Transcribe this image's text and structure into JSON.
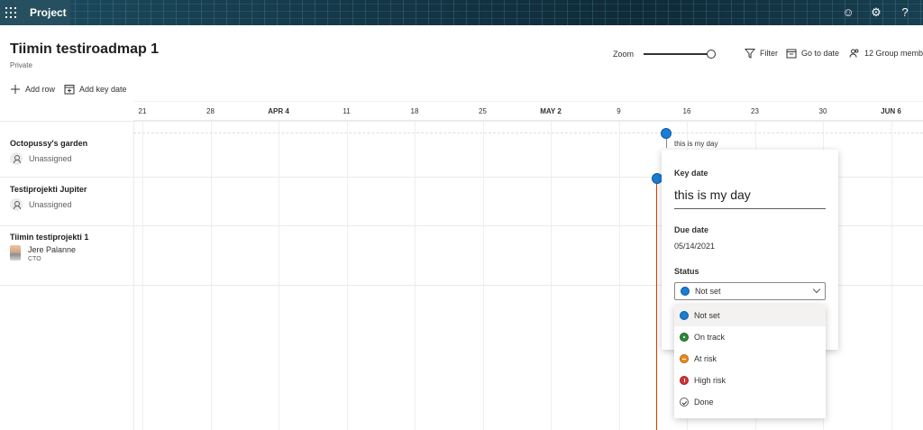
{
  "app": {
    "name": "Project"
  },
  "roadmap": {
    "title": "Tiimin testiroadmap 1",
    "privacy": "Private"
  },
  "toolbar": {
    "zoom_label": "Zoom",
    "zoom_level": 0.95,
    "filter_label": "Filter",
    "goto_label": "Go to date",
    "members_label": "12 Group memb",
    "add_row_label": "Add row",
    "add_key_date_label": "Add key date"
  },
  "timeline": {
    "ticks": [
      "21",
      "28",
      "APR 4",
      "11",
      "18",
      "25",
      "MAY 2",
      "9",
      "16",
      "23",
      "30",
      "JUN 6"
    ]
  },
  "rows": [
    {
      "name": "Octopussy's garden",
      "assignee": "Unassigned"
    },
    {
      "name": "Testiprojekti Jupiter",
      "assignee": "Unassigned"
    },
    {
      "name": "Tiimin testiprojekti 1",
      "assignee": "Jere Palanne",
      "role": "CTO"
    }
  ],
  "keydate": {
    "label": "this is my day",
    "panel_header": "Key date",
    "title": "this is my day",
    "due_label": "Due date",
    "due_value": "05/14/2021",
    "status_label": "Status",
    "status_value": "Not set"
  },
  "status_options": [
    {
      "label": "Not set",
      "icon": "blue-circle-icon"
    },
    {
      "label": "On track",
      "icon": "green-circle-icon"
    },
    {
      "label": "At risk",
      "icon": "orange-circle-icon"
    },
    {
      "label": "High risk",
      "icon": "red-circle-icon"
    },
    {
      "label": "Done",
      "icon": "check-circle-icon"
    }
  ],
  "colors": {
    "accent": "#1a7dd6",
    "today_line": "#d83b01"
  }
}
